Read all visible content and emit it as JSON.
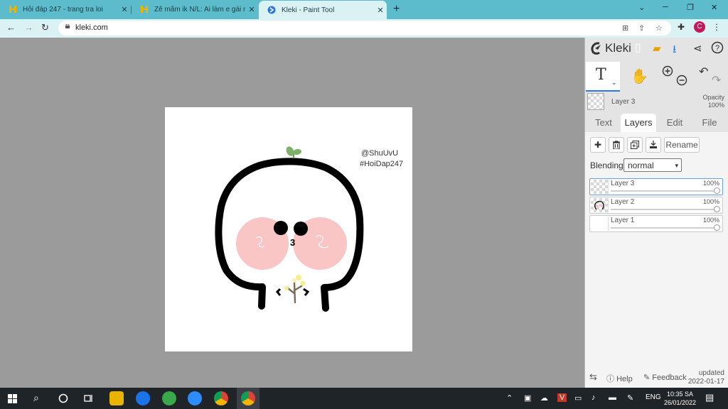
{
  "browser": {
    "tabs": [
      {
        "title": "Hỏi đáp 247 - trang tra loi",
        "close": "✕"
      },
      {
        "title": "Zê mãm ik N/L: Ai làm e gái nui t",
        "close": "✕"
      },
      {
        "title": "Kleki - Paint Tool",
        "close": "✕"
      }
    ],
    "new_tab": "+",
    "url": "kleki.com",
    "profile_initial": "C"
  },
  "app": {
    "brand": "Kleki",
    "active_layer_name": "Layer 3",
    "opacity_label": "Opacity",
    "opacity_value": "100%",
    "tabs": [
      "Text",
      "Layers",
      "Edit",
      "File"
    ],
    "selected_tab": "Layers",
    "tool_text_glyph": "T",
    "rename_label": "Rename",
    "blending_label": "Blending",
    "blending_value": "normal",
    "layers": [
      {
        "name": "Layer 3",
        "opacity": "100%",
        "opacity_fraction": 1.0,
        "active": true
      },
      {
        "name": "Layer 2",
        "opacity": "100%",
        "opacity_fraction": 1.0,
        "active": false
      },
      {
        "name": "Layer 1",
        "opacity": "100%",
        "opacity_fraction": 1.0,
        "active": false
      }
    ],
    "footer": {
      "help": "Help",
      "feedback": "Feedback",
      "updated_label": "updated",
      "updated_date": "2022-01-17"
    }
  },
  "canvas": {
    "watermark_line1": "@ShuUvU",
    "watermark_line2": "#HoiDap247",
    "mouth_text": "3"
  },
  "taskbar": {
    "language": "ENG",
    "time": "10:35 SA",
    "date": "26/01/2022"
  },
  "colors": {
    "tab_strip": "#5cbccb",
    "active_tab": "#dbf2f5",
    "accent_blue": "#2b78e4",
    "cheek_pink": "#f9c5c5"
  }
}
